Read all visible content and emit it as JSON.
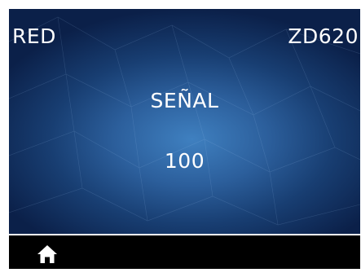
{
  "header": {
    "menu_title": "RED",
    "model": "ZD620"
  },
  "setting": {
    "name": "SEÑAL",
    "value": "100"
  },
  "footer": {
    "home_icon": "home-icon"
  },
  "colors": {
    "screen_background": "#000000",
    "panel_gradient_center": "#3f80c0",
    "panel_gradient_edge": "#0b2049",
    "text": "#ffffff"
  }
}
